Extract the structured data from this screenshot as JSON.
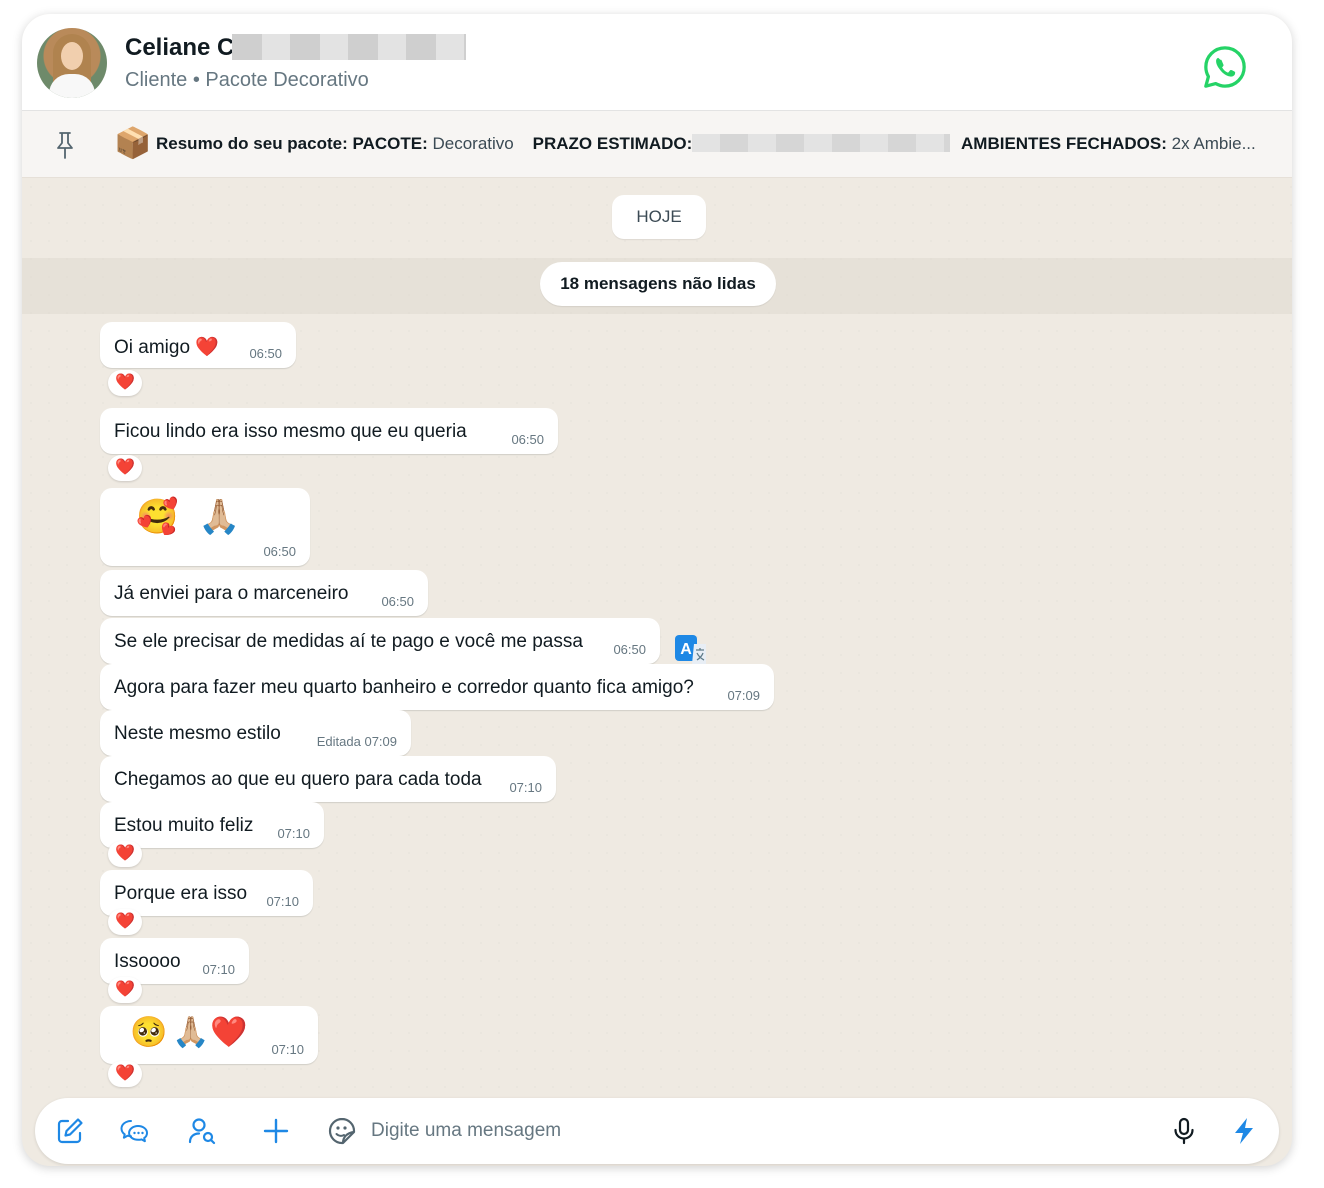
{
  "header": {
    "contact_name": "Celiane C",
    "subtitle": "Cliente • Pacote Decorativo",
    "avatar_icon": "contact-avatar",
    "whatsapp_icon": "whatsapp-icon"
  },
  "pinned": {
    "box_emoji": "📦",
    "label": "Resumo do seu pacote:",
    "pacote_key": "PACOTE:",
    "pacote_value": "Decorativo",
    "prazo_key": "PRAZO ESTIMADO:",
    "ambientes_key": "AMBIENTES FECHADOS:",
    "ambientes_value": "2x Ambie..."
  },
  "chat": {
    "date_label": "HOJE",
    "unread_label": "18 mensagens não lidas",
    "messages": [
      {
        "text": "Oi amigo ❤️",
        "time": "06:50",
        "reaction": "❤️"
      },
      {
        "text": "Ficou lindo era isso mesmo que eu queria",
        "time": "06:50",
        "reaction": "❤️"
      },
      {
        "emojis": [
          "🥰",
          "🙏🏼"
        ],
        "time": "06:50"
      },
      {
        "text": "Já enviei para o marceneiro",
        "time": "06:50"
      },
      {
        "text": "Se ele precisar de medidas aí te pago e você me passa",
        "time": "06:50"
      },
      {
        "text": "Agora para fazer meu quarto banheiro e corredor quanto fica amigo?",
        "time": "07:09"
      },
      {
        "text": "Neste mesmo estilo",
        "time": "Editada 07:09"
      },
      {
        "text": "Chegamos ao que eu quero para cada toda",
        "time": "07:10"
      },
      {
        "text": "Estou muito feliz",
        "time": "07:10",
        "reaction": "❤️"
      },
      {
        "text": "Porque era isso",
        "time": "07:10",
        "reaction": "❤️"
      },
      {
        "text": "Issoooo",
        "time": "07:10",
        "reaction": "❤️"
      },
      {
        "emojis": [
          "🥺",
          "🙏🏼",
          "❤️"
        ],
        "time": "07:10",
        "reaction": "❤️"
      }
    ]
  },
  "composer": {
    "placeholder": "Digite uma mensagem"
  },
  "colors": {
    "chat_bg": "#efeae2",
    "bubble": "#ffffff",
    "whatsapp_green": "#25d366",
    "accent_blue": "#1e88e5"
  }
}
